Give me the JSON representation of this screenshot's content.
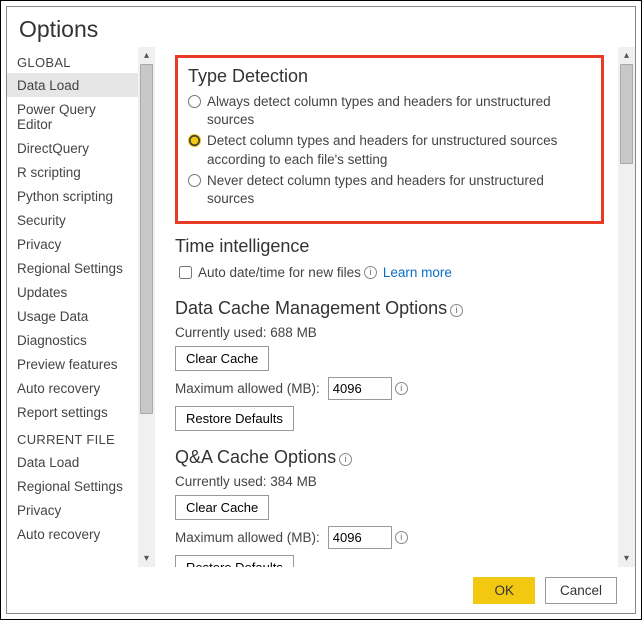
{
  "window_title": "Options",
  "sidebar": {
    "global_header": "GLOBAL",
    "current_file_header": "CURRENT FILE",
    "global_items": [
      "Data Load",
      "Power Query Editor",
      "DirectQuery",
      "R scripting",
      "Python scripting",
      "Security",
      "Privacy",
      "Regional Settings",
      "Updates",
      "Usage Data",
      "Diagnostics",
      "Preview features",
      "Auto recovery",
      "Report settings"
    ],
    "current_file_items": [
      "Data Load",
      "Regional Settings",
      "Privacy",
      "Auto recovery"
    ],
    "selected": "Data Load"
  },
  "type_detection": {
    "heading": "Type Detection",
    "opt_always": "Always detect column types and headers for unstructured sources",
    "opt_each": "Detect column types and headers for unstructured sources according to each file's setting",
    "opt_never": "Never detect column types and headers for unstructured sources",
    "selected": "each"
  },
  "time_intel": {
    "heading": "Time intelligence",
    "auto_datetime_label": "Auto date/time for new files",
    "learn_more": "Learn more"
  },
  "data_cache": {
    "heading": "Data Cache Management Options",
    "currently_used_label": "Currently used: 688 MB",
    "clear_label": "Clear Cache",
    "max_label": "Maximum allowed (MB):",
    "max_value": "4096",
    "restore_label": "Restore Defaults"
  },
  "qa_cache": {
    "heading": "Q&A Cache Options",
    "currently_used_label": "Currently used: 384 MB",
    "clear_label": "Clear Cache",
    "max_label": "Maximum allowed (MB):",
    "max_value": "4096",
    "restore_label": "Restore Defaults"
  },
  "footer": {
    "ok": "OK",
    "cancel": "Cancel"
  }
}
